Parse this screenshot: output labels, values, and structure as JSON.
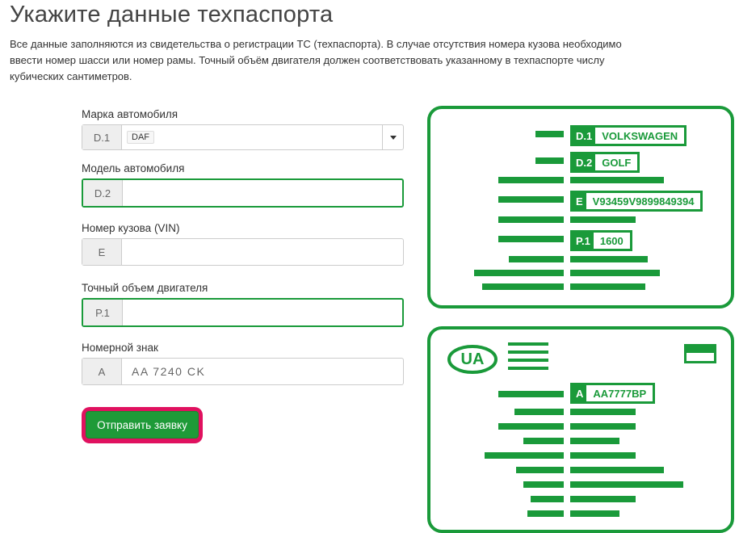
{
  "page": {
    "title": "Укажите данные техпаспорта",
    "description": "Все данные заполняются из свидетельства о регистрации ТС (техпаспорта). В случае отсутствия номера кузова необходимо ввести номер шасси или номер рамы. Точный объём двигателя должен соответствовать указанному в техпаспорте числу кубических сантиметров."
  },
  "form": {
    "make": {
      "label": "Марка автомобиля",
      "code": "D.1",
      "value": "DAF"
    },
    "model": {
      "label": "Модель автомобиля",
      "code": "D.2",
      "value": ""
    },
    "vin": {
      "label": "Номер кузова (VIN)",
      "code": "E",
      "value": ""
    },
    "engine": {
      "label": "Точный объем двигателя",
      "code": "P.1",
      "value": ""
    },
    "plate": {
      "label": "Номерной знак",
      "code": "A",
      "placeholder": "AA 7240 CK"
    },
    "submit_label": "Отправить заявку"
  },
  "illustration": {
    "top_card": [
      {
        "code": "D.1",
        "value": "VOLKSWAGEN"
      },
      {
        "code": "D.2",
        "value": "GOLF"
      },
      {
        "code": "E",
        "value": "V93459V9899849394"
      },
      {
        "code": "P.1",
        "value": "1600"
      }
    ],
    "bottom_card": {
      "country": "UA",
      "plate": {
        "code": "A",
        "value": "AA7777BP"
      }
    }
  },
  "colors": {
    "accent": "#1a9a3a",
    "highlight": "#e0115f"
  }
}
